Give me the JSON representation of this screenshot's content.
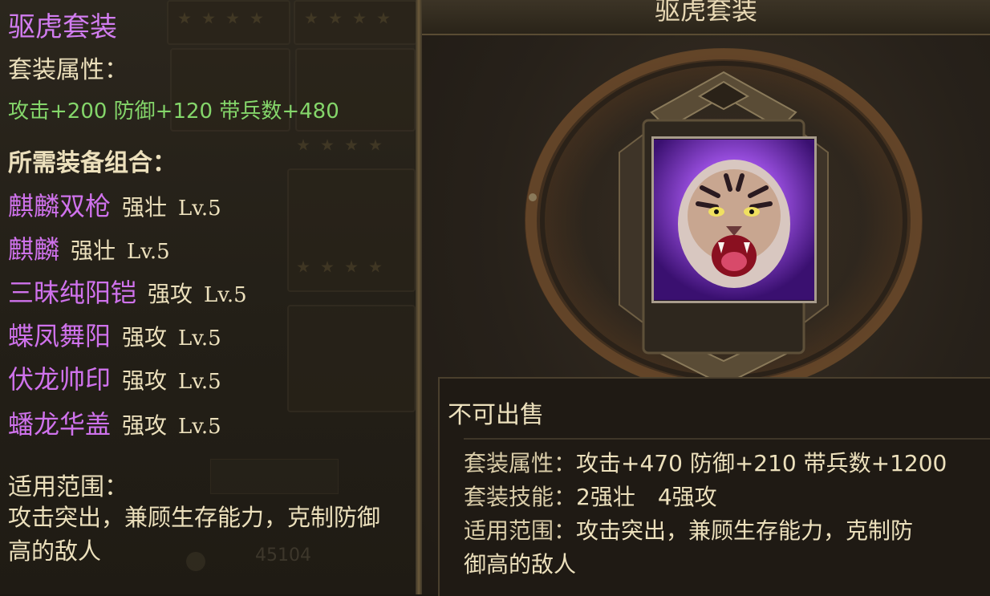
{
  "left_panel": {
    "set_title": "驱虎套装",
    "attr_header": "套装属性：",
    "set_attrs": "攻击+200 防御+120 带兵数+480",
    "required_header": "所需装备组合：",
    "items": [
      {
        "name": "麒麟双枪",
        "prop": "强壮",
        "level": "Lv.5"
      },
      {
        "name": "麒麟",
        "prop": "强壮",
        "level": "Lv.5"
      },
      {
        "name": "三昧纯阳铠",
        "prop": "强攻",
        "level": "Lv.5"
      },
      {
        "name": "蝶凤舞阳",
        "prop": "强攻",
        "level": "Lv.5"
      },
      {
        "name": "伏龙帅印",
        "prop": "强攻",
        "level": "Lv.5"
      },
      {
        "name": "蟠龙华盖",
        "prop": "强攻",
        "level": "Lv.5"
      }
    ],
    "scope_header": "适用范围：",
    "scope_text": "攻击突出，兼顾生存能力，克制防御高的敌人",
    "background_number": "45104"
  },
  "right_panel": {
    "title": "驱虎套装",
    "portrait_icon": "tiger-portrait-icon",
    "unsellable": "不可出售",
    "set_attrs_label": "套装属性：",
    "set_attrs_value": "攻击+470 防御+210 带兵数+1200",
    "set_skill_label": "套装技能：",
    "set_skill_value": "2强壮　4强攻",
    "scope_label": "适用范围：",
    "scope_value_line1": "攻击突出，兼顾生存能力，克制防",
    "scope_value_line2": "御高的敌人"
  },
  "colors": {
    "set_name_purple": "#d27df0",
    "item_name_purple": "#cf72ec",
    "attr_green": "#84d66a",
    "text_cream": "#ece0bc",
    "frame_bronze": "#6b5a3b"
  }
}
